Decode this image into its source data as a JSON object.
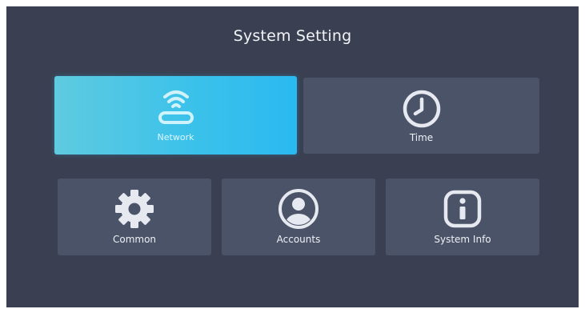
{
  "screen": {
    "title": "System Setting"
  },
  "menu": {
    "selected": "network",
    "tiles": {
      "network": {
        "label": "Network",
        "icon": "router-wifi-icon"
      },
      "time": {
        "label": "Time",
        "icon": "clock-icon"
      },
      "common": {
        "label": "Common",
        "icon": "gear-icon"
      },
      "accounts": {
        "label": "Accounts",
        "icon": "user-icon"
      },
      "system_info": {
        "label": "System Info",
        "icon": "info-icon"
      }
    }
  },
  "colors": {
    "background": "#3a4052",
    "tile": "#4a5367",
    "selected_accent": "#2ab9f0",
    "icon": "#e6e9ef"
  }
}
